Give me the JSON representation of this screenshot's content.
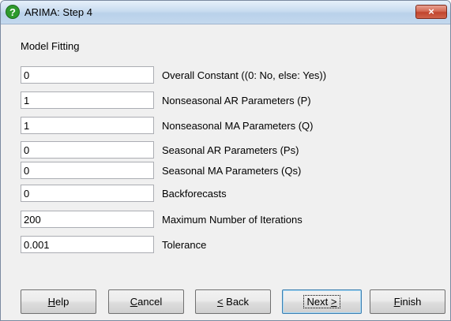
{
  "window": {
    "title": "ARIMA: Step 4",
    "close_label": "×"
  },
  "section": {
    "label": "Model Fitting"
  },
  "fields": [
    {
      "value": "0",
      "label": "Overall Constant ((0: No, else: Yes))"
    },
    {
      "value": "1",
      "label": "Nonseasonal AR Parameters (P)"
    },
    {
      "value": "1",
      "label": "Nonseasonal MA Parameters (Q)"
    },
    {
      "value": "0",
      "label": "Seasonal AR Parameters (Ps)"
    },
    {
      "value": "0",
      "label": "Seasonal MA Parameters (Qs)"
    },
    {
      "value": "0",
      "label": "Backforecasts"
    },
    {
      "value": "200",
      "label": "Maximum Number of Iterations"
    },
    {
      "value": "0.001",
      "label": "Tolerance"
    }
  ],
  "buttons": {
    "help": {
      "mnemonic": "H",
      "rest": "elp"
    },
    "cancel": {
      "mnemonic": "C",
      "rest": "ancel"
    },
    "back": {
      "mnemonic": "<",
      "rest": " Back"
    },
    "next": {
      "pre": "Next ",
      "mnemonic": ">"
    },
    "finish": {
      "mnemonic": "F",
      "rest": "inish"
    }
  },
  "icons": {
    "title": "help-question-icon",
    "close": "close-icon"
  },
  "colors": {
    "title_icon": "#2e9a2e",
    "close_button": "#c8503a"
  }
}
